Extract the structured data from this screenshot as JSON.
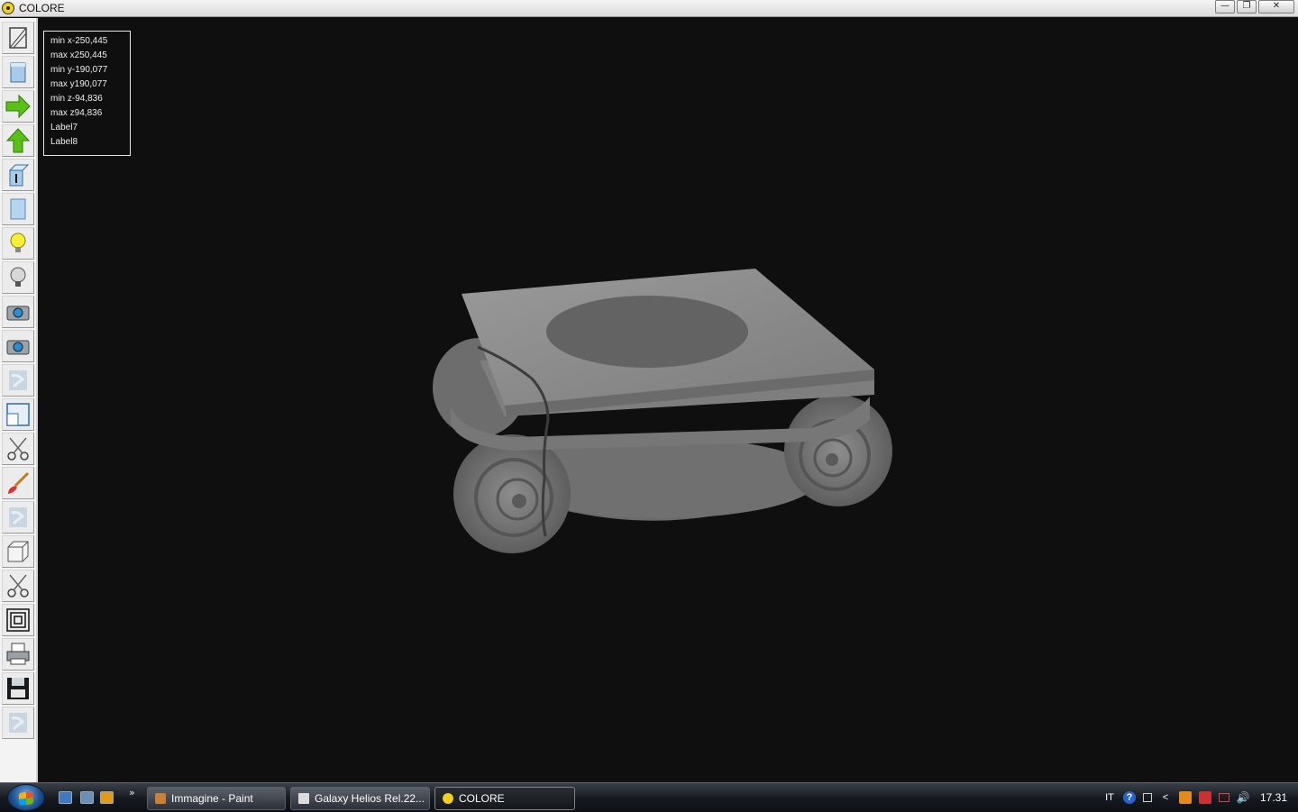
{
  "window": {
    "title": "COLORE",
    "minimize": "—",
    "restore": "❐",
    "close": "✕"
  },
  "toolbar": {
    "tools": [
      {
        "name": "wireframe-tool",
        "icon": "wireframe-box-icon"
      },
      {
        "name": "solid-view-tool",
        "icon": "solid-box-icon"
      },
      {
        "name": "move-right-tool",
        "icon": "green-arrow-right-icon"
      },
      {
        "name": "move-up-tool",
        "icon": "green-arrow-up-icon"
      },
      {
        "name": "extrude-tool",
        "icon": "box-arrow-icon"
      },
      {
        "name": "shade-tool",
        "icon": "blue-panel-icon"
      },
      {
        "name": "light-on-tool",
        "icon": "lightbulb-on-icon"
      },
      {
        "name": "light-off-tool",
        "icon": "lightbulb-off-icon"
      },
      {
        "name": "camera-tool-1",
        "icon": "camera-icon"
      },
      {
        "name": "camera-tool-2",
        "icon": "camera-icon"
      },
      {
        "name": "texture-tool-1",
        "icon": "marble-texture-icon"
      },
      {
        "name": "window-tool",
        "icon": "window-icon"
      },
      {
        "name": "cut-tool-1",
        "icon": "scissors-icon"
      },
      {
        "name": "brush-tool",
        "icon": "paint-brush-icon"
      },
      {
        "name": "texture-tool-2",
        "icon": "marble-texture-icon"
      },
      {
        "name": "cube-tool",
        "icon": "cube-icon"
      },
      {
        "name": "cut-tool-2",
        "icon": "scissors-icon"
      },
      {
        "name": "frames-tool",
        "icon": "concentric-squares-icon"
      },
      {
        "name": "print-tool",
        "icon": "printer-icon"
      },
      {
        "name": "save-tool",
        "icon": "floppy-disk-icon"
      },
      {
        "name": "texture-tool-3",
        "icon": "marble-texture-icon"
      }
    ]
  },
  "info": {
    "min_x": "min x-250,445",
    "max_x": "max x250,445",
    "min_y": "min y-190,077",
    "max_y": "max y190,077",
    "min_z": "min z-94,836",
    "max_z": "max z94,836",
    "label7": "Label7",
    "label8": "Label8"
  },
  "taskbar": {
    "more": "»",
    "tasks": [
      {
        "label": "Immagine - Paint"
      },
      {
        "label": "Galaxy Helios  Rel.22..."
      },
      {
        "label": "COLORE"
      }
    ],
    "tray": {
      "lang": "IT",
      "help": "?",
      "arrow": "<",
      "clock": "17.31"
    }
  },
  "colors": {
    "viewport_bg": "#0f0f0f",
    "marble": "#8a8a8a"
  }
}
